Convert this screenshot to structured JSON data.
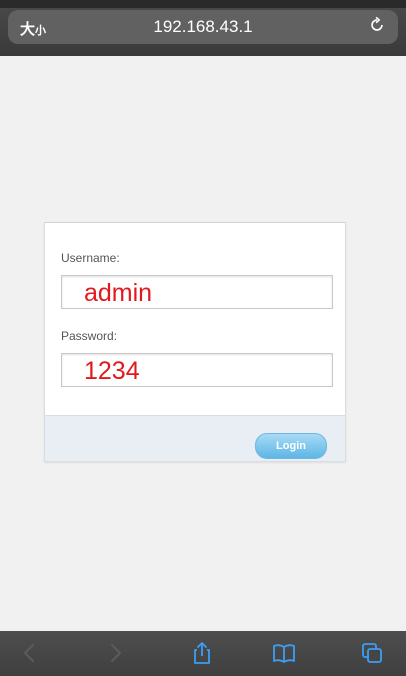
{
  "browser": {
    "text_size_label_main": "大",
    "text_size_label_small": "小",
    "url": "192.168.43.1",
    "icons": {
      "reload": "reload-icon",
      "back": "back-arrow-icon",
      "forward": "forward-arrow-icon",
      "share": "share-icon",
      "bookmarks": "bookmarks-icon",
      "tabs": "tabs-icon"
    }
  },
  "login": {
    "username_label": "Username:",
    "username_value": "admin",
    "password_label": "Password:",
    "password_value": "1234",
    "login_button": "Login"
  }
}
